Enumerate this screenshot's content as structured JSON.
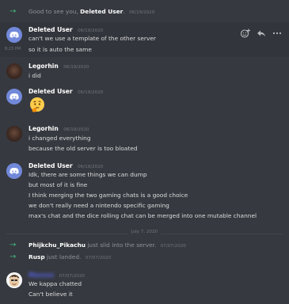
{
  "colors": {
    "background": "#36393f",
    "hover_background": "#32353b",
    "join_arrow": "#43b581",
    "username": "#ffffff",
    "muted": "#72767d",
    "blurred_username": "#5865f2"
  },
  "messages": {
    "sys1": {
      "text": "Good to see you,",
      "user": "Deleted User",
      "suffix": ".",
      "time": "06/19/2020"
    },
    "g1": {
      "user": "Deleted User",
      "time": "06/19/2020",
      "lines": [
        "can't we use a template of the other server",
        "so it is auto the same"
      ],
      "side_time": "8:23 PM"
    },
    "g2": {
      "user": "Legorhin",
      "time": "06/19/2020",
      "lines": [
        "i did"
      ]
    },
    "g3": {
      "user": "Deleted User",
      "time": "06/19/2020",
      "emoji": "thinking-face"
    },
    "g4": {
      "user": "Legorhin",
      "time": "06/19/2020",
      "lines": [
        "i changed everything",
        "because the old server is too bloated"
      ]
    },
    "g5": {
      "user": "Deleted User",
      "time": "06/19/2020",
      "lines": [
        "Idk, there are some things we can dump",
        "but most of it is fine",
        "I think merging the two gaming chats is a good choice",
        "we don't really need a nintendo specific gaming",
        "max's chat and the dice rolling chat can be merged into one mutable channel"
      ]
    },
    "divider": "July 7, 2020",
    "sys2": {
      "user": "Phijkchu_Pikachu",
      "text": "just slid into the server.",
      "time": "07/07/2020"
    },
    "sys3": {
      "user": "Rusp",
      "text": "just landed.",
      "time": "07/07/2020"
    },
    "g6": {
      "user": "Maxxxx",
      "time": "07/07/2020",
      "lines": [
        "We kappa chatted",
        "Can't believe it"
      ]
    }
  },
  "toolbar_icons": [
    "add-reaction-icon",
    "reply-icon",
    "more-options-icon"
  ]
}
